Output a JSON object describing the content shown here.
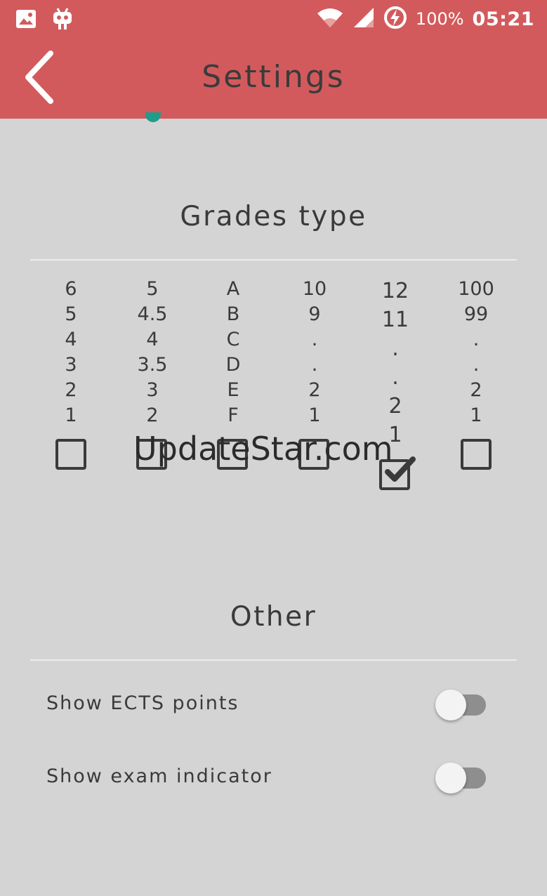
{
  "status_bar": {
    "icons_left": [
      "image-icon",
      "android-icon"
    ],
    "icons_right": [
      "wifi-icon",
      "signal-icon",
      "battery-charging-icon"
    ],
    "battery": "100%",
    "time": "05:21"
  },
  "app_bar": {
    "title": "Settings",
    "back_icon": "chevron-left-icon",
    "color": "#d35a5c"
  },
  "grades": {
    "title": "Grades type",
    "columns": [
      {
        "values": [
          "6",
          "5",
          "4",
          "3",
          "2",
          "1"
        ],
        "checked": false
      },
      {
        "values": [
          "5",
          "4.5",
          "4",
          "3.5",
          "3",
          "2"
        ],
        "checked": false
      },
      {
        "values": [
          "A",
          "B",
          "C",
          "D",
          "E",
          "F"
        ],
        "checked": false
      },
      {
        "values": [
          "10",
          "9",
          ".",
          ".",
          "2",
          "1"
        ],
        "checked": false
      },
      {
        "values": [
          "12",
          "11",
          ".",
          ".",
          "2",
          "1"
        ],
        "checked": true
      },
      {
        "values": [
          "100",
          "99",
          ".",
          ".",
          "2",
          "1"
        ],
        "checked": false
      }
    ]
  },
  "other": {
    "title": "Other",
    "toggles": [
      {
        "label": "Show ECTS points",
        "on": false
      },
      {
        "label": "Show exam indicator",
        "on": false
      }
    ]
  },
  "watermark": "UpdateStar.com"
}
